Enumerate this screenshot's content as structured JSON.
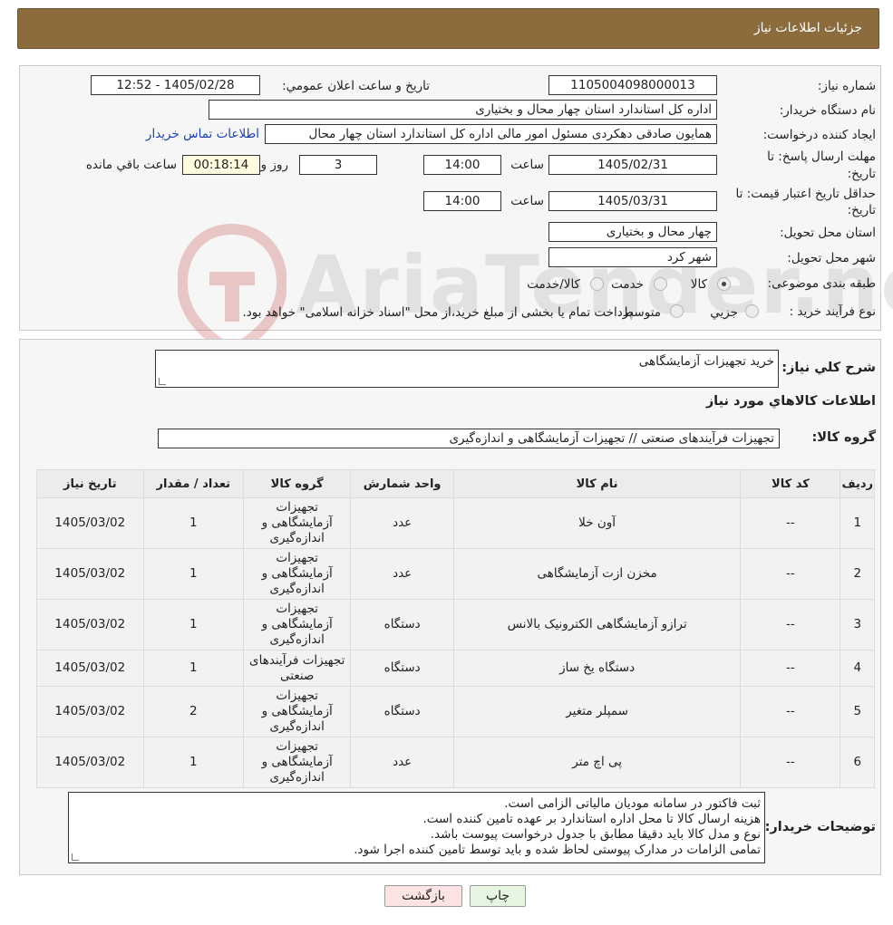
{
  "header": {
    "title": "جزئیات اطلاعات نیاز"
  },
  "info": {
    "need_number_label": "شماره نیاز:",
    "need_number": "1105004098000013",
    "announce_label": "تاریخ و ساعت اعلان عمومي:",
    "announce_value": "1405/02/28 - 12:52",
    "buyer_label": "نام دستگاه خريدار:",
    "buyer_value": "اداره کل استاندارد استان چهار محال و بختیاری",
    "creator_label": "ايجاد کننده درخواست:",
    "creator_value": "همایون صادقی دهکردی مسئول امور مالی اداره کل استاندارد استان چهار محال",
    "contact_link": "اطلاعات تماس خريدار",
    "deadline_label_1": "مهلت ارسال پاسخ: تا",
    "deadline_label_2": "تاريخ:",
    "deadline_date": "1405/02/31",
    "time_label": "ساعت",
    "deadline_time": "14:00",
    "days_value": "3",
    "days_label": "روز و",
    "remaining_time": "00:18:14",
    "remaining_label": "ساعت باقي مانده",
    "validity_label_1": "حداقل تاريخ اعتبار قيمت: تا",
    "validity_label_2": "تاريخ:",
    "validity_date": "1405/03/31",
    "validity_time": "14:00",
    "province_label": "استان محل تحويل:",
    "province_value": "چهار محال و بختیاری",
    "city_label": "شهر محل تحويل:",
    "city_value": "شهر کرد",
    "category_label": "طبقه بندی موضوعی:",
    "category_options": [
      "کالا",
      "خدمت",
      "کالا/خدمت"
    ],
    "category_selected": "کالا",
    "process_label": "نوع فرآيند خريد :",
    "process_options": [
      "جزيي",
      "متوسط"
    ],
    "process_note": "پرداخت تمام یا بخشی از مبلغ خرید،از محل \"اسناد خزانه اسلامی\" خواهد بود."
  },
  "watermark": {
    "text": "AriaTender.neT"
  },
  "summary": {
    "label": "شرح كلي نياز:",
    "value": "خرید تجهیزات آزمایشگاهی"
  },
  "goods_section": {
    "title": "اطلاعات كالاهاي مورد نياز",
    "group_label": "گروه كالا:",
    "group_value": "تجهیزات فرآیندهای صنعتی // تجهیزات آزمایشگاهی و اندازه‌گیری"
  },
  "table": {
    "headers": [
      "رديف",
      "كد كالا",
      "نام كالا",
      "واحد شمارش",
      "گروه كالا",
      "تعداد / مقدار",
      "تاريخ نياز"
    ],
    "rows": [
      [
        "1",
        "--",
        "آون خلا",
        "عدد",
        "تجهیزات آزمایشگاهی و اندازه‌گیری",
        "1",
        "1405/03/02"
      ],
      [
        "2",
        "--",
        "مخزن ازت آزمایشگاهی",
        "عدد",
        "تجهیزات آزمایشگاهی و اندازه‌گیری",
        "1",
        "1405/03/02"
      ],
      [
        "3",
        "--",
        "ترازو آزمایشگاهی الکترونیک بالانس",
        "دستگاه",
        "تجهیزات آزمایشگاهی و اندازه‌گیری",
        "1",
        "1405/03/02"
      ],
      [
        "4",
        "--",
        "دستگاه یخ ساز",
        "دستگاه",
        "تجهیزات فرآیندهای صنعتی",
        "1",
        "1405/03/02"
      ],
      [
        "5",
        "--",
        "سمپلر متغیر",
        "دستگاه",
        "تجهیزات آزمایشگاهی و اندازه‌گیری",
        "2",
        "1405/03/02"
      ],
      [
        "6",
        "--",
        "پی اچ متر",
        "عدد",
        "تجهیزات آزمایشگاهی و اندازه‌گیری",
        "1",
        "1405/03/02"
      ]
    ]
  },
  "notes": {
    "label": "توضيحات خريدار:",
    "lines": [
      "ثبت فاکتور در سامانه مودیان مالیاتی الزامی است.",
      "هزینه ارسال کالا تا محل اداره استاندارد بر عهده تامین کننده است.",
      "نوع و مدل کالا باید دقیقا مطابق با جدول درخواست پیوست باشد.",
      "تمامی الزامات در مدارک پیوستی لحاظ شده و باید توسط تامین کننده اجرا شود."
    ]
  },
  "buttons": {
    "print": "چاپ",
    "back": "بازگشت"
  },
  "colors": {
    "header": "#8c6b3c",
    "link": "#1a3fb0",
    "back_button": "#fde3e3",
    "print_button": "#e6f6e2"
  }
}
